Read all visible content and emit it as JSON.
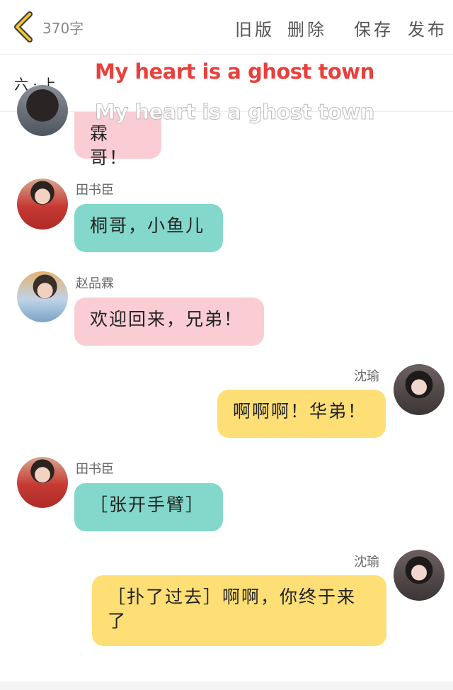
{
  "header": {
    "word_count": "370字",
    "actions": [
      "旧版",
      "删除",
      "保存",
      "发布"
    ]
  },
  "subheader": {
    "chapter": "六 · 上",
    "song_title": "My heart is a ghost town"
  },
  "colors": {
    "pink_bubble": "#f9cdd3",
    "teal_bubble": "#84d7cb",
    "yellow_bubble": "#fddf76",
    "song_red": "#e8403c"
  },
  "messages": [
    {
      "sender": "",
      "text": "霖哥！",
      "side": "left",
      "color": "pink"
    },
    {
      "sender": "田书臣",
      "text": "桐哥，小鱼儿",
      "side": "left",
      "color": "teal"
    },
    {
      "sender": "赵品霖",
      "text": "欢迎回来，兄弟！",
      "side": "left",
      "color": "pink"
    },
    {
      "sender": "沈瑜",
      "text": "啊啊啊！华弟！",
      "side": "right",
      "color": "yellow"
    },
    {
      "sender": "田书臣",
      "text": "［张开手臂］",
      "side": "left",
      "color": "teal"
    },
    {
      "sender": "沈瑜",
      "text": "［扑了过去］啊啊，你终于来了",
      "side": "right",
      "color": "yellow"
    }
  ]
}
